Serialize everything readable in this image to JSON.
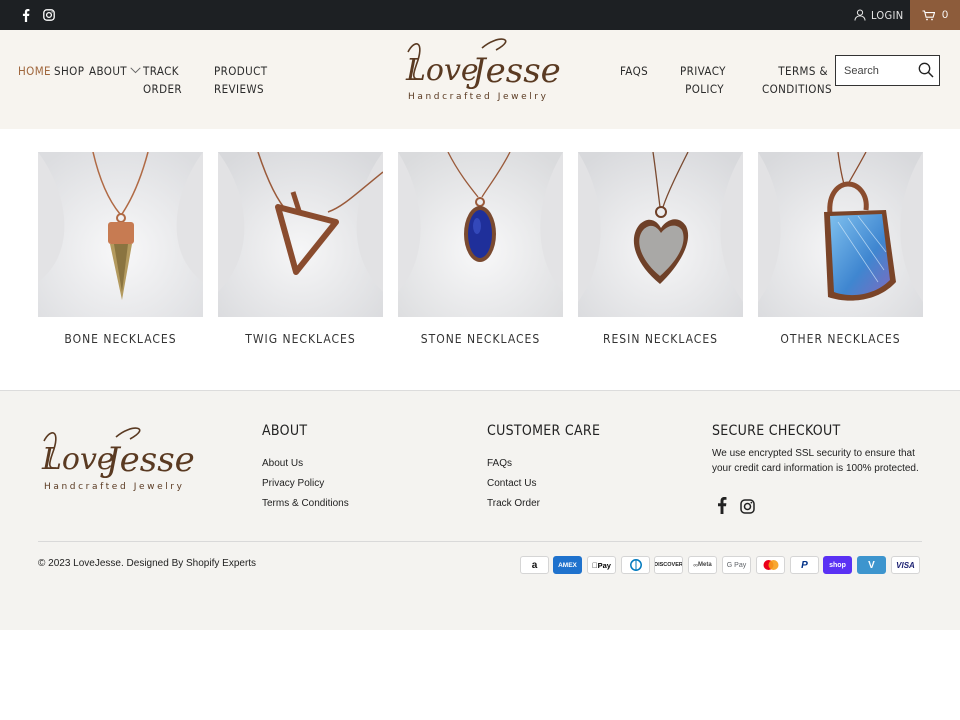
{
  "topbar": {
    "social": [
      {
        "name": "facebook-icon"
      },
      {
        "name": "instagram-icon"
      }
    ],
    "login_label": "LOGIN",
    "cart_count": "0",
    "cart_color": "#8d5c3b"
  },
  "header": {
    "nav_left": [
      {
        "label": "HOME",
        "active": true
      },
      {
        "label": "SHOP"
      },
      {
        "label": "ABOUT"
      },
      {
        "label": "TRACK\nORDER"
      },
      {
        "label": "PRODUCT\nREVIEWS"
      }
    ],
    "nav_right": [
      {
        "label": "FAQS"
      },
      {
        "label": "PRIVACY\nPOLICY"
      },
      {
        "label": "TERMS &\nCONDITIONS"
      }
    ],
    "logo": {
      "script": "Love Jesse",
      "tagline": "Handcrafted Jewelry"
    },
    "search": {
      "placeholder": "Search"
    },
    "accent_color": "#a0673d"
  },
  "products": [
    {
      "label": "BONE NECKLACES"
    },
    {
      "label": "TWIG NECKLACES"
    },
    {
      "label": "STONE NECKLACES"
    },
    {
      "label": "RESIN NECKLACES"
    },
    {
      "label": "OTHER NECKLACES"
    }
  ],
  "footer": {
    "logo": {
      "script": "Love Jesse",
      "tagline": "Handcrafted Jewelry"
    },
    "about": {
      "title": "ABOUT",
      "links": [
        "About Us",
        "Privacy Policy",
        "Terms & Conditions"
      ]
    },
    "customer_care": {
      "title": "CUSTOMER CARE",
      "links": [
        "FAQs",
        "Contact Us",
        "Track Order"
      ]
    },
    "secure_checkout": {
      "title": "SECURE CHECKOUT",
      "text": "We use encrypted SSL security to ensure that your credit card information is 100% protected."
    },
    "copyright": "© 2023 LoveJesse. Designed By Shopify Experts",
    "payments": [
      {
        "name": "amazon-pay-icon",
        "label": "a"
      },
      {
        "name": "amex-icon",
        "label": "AMEX"
      },
      {
        "name": "apple-pay-icon",
        "label": "Pay"
      },
      {
        "name": "diners-club-icon",
        "label": ""
      },
      {
        "name": "discover-icon",
        "label": "DISCOVER"
      },
      {
        "name": "meta-pay-icon",
        "label": "Meta"
      },
      {
        "name": "google-pay-icon",
        "label": "G Pay"
      },
      {
        "name": "mastercard-icon",
        "label": ""
      },
      {
        "name": "paypal-icon",
        "label": "P"
      },
      {
        "name": "shop-pay-icon",
        "label": "shop"
      },
      {
        "name": "venmo-icon",
        "label": "V"
      },
      {
        "name": "visa-icon",
        "label": "VISA"
      }
    ]
  }
}
